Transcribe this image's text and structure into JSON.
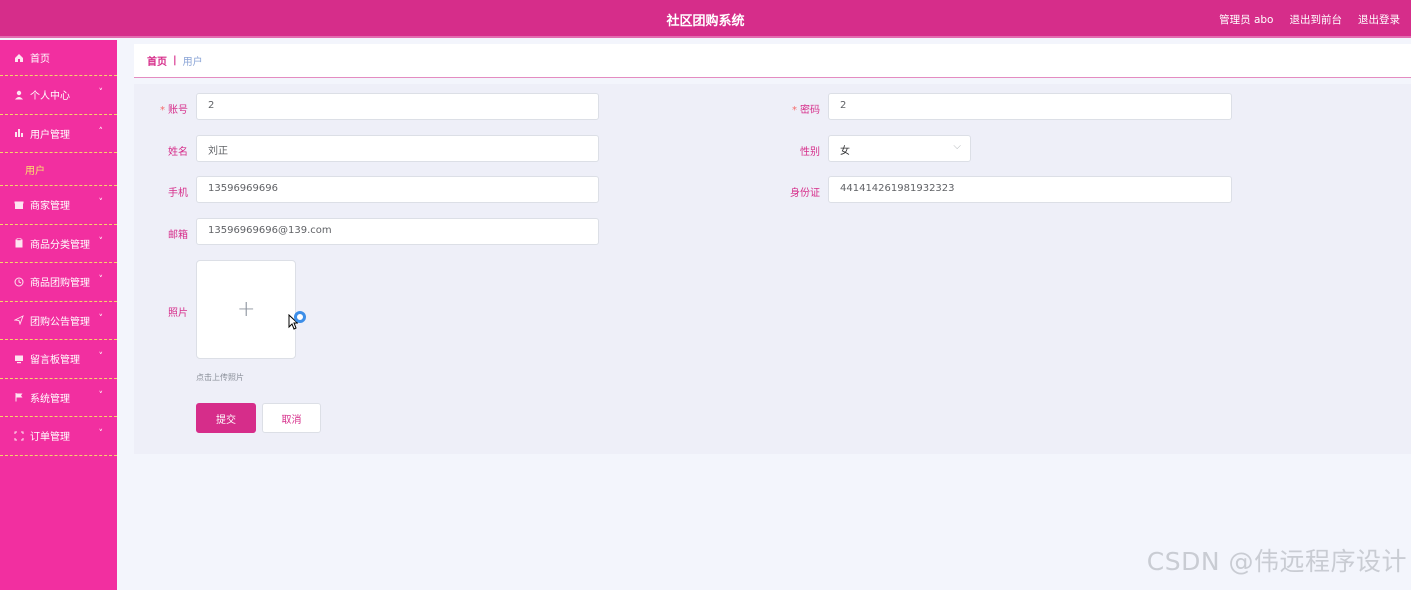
{
  "header": {
    "title": "社区团购系统",
    "admin_label": "管理员 abo",
    "back_label": "退出到前台",
    "logout_label": "退出登录"
  },
  "sidebar": {
    "items": [
      {
        "label": "首页",
        "icon": "home-icon"
      },
      {
        "label": "个人中心",
        "icon": "user-icon"
      },
      {
        "label": "用户管理",
        "icon": "bar-chart-icon"
      },
      {
        "label": "用户",
        "icon": ""
      },
      {
        "label": "商家管理",
        "icon": "shop-icon"
      },
      {
        "label": "商品分类管理",
        "icon": "clipboard-icon"
      },
      {
        "label": "商品团购管理",
        "icon": "clock-icon"
      },
      {
        "label": "团购公告管理",
        "icon": "send-icon"
      },
      {
        "label": "留言板管理",
        "icon": "monitor-icon"
      },
      {
        "label": "系统管理",
        "icon": "flag-icon"
      },
      {
        "label": "订单管理",
        "icon": "crop-icon"
      }
    ]
  },
  "breadcrumb": {
    "home": "首页",
    "separator": "|",
    "current": "用户"
  },
  "form": {
    "account_label": "账号",
    "account_value": "2",
    "password_label": "密码",
    "password_value": "2",
    "name_label": "姓名",
    "name_value": "刘正",
    "gender_label": "性别",
    "gender_value": "女",
    "phone_label": "手机",
    "phone_value": "13596969696",
    "id_label": "身份证",
    "id_value": "441414261981932323",
    "email_label": "邮箱",
    "email_value": "13596969696@139.com",
    "photo_label": "照片",
    "upload_tip": "点击上传照片",
    "submit_label": "提交",
    "cancel_label": "取消",
    "required_mark": "*"
  },
  "watermark": "CSDN @伟远程序设计",
  "colors": {
    "header_bg": "#d62d8a",
    "sidebar_bg": "#f22fa0",
    "submenu_text": "#f9e36c",
    "accent": "#d62d8a"
  }
}
